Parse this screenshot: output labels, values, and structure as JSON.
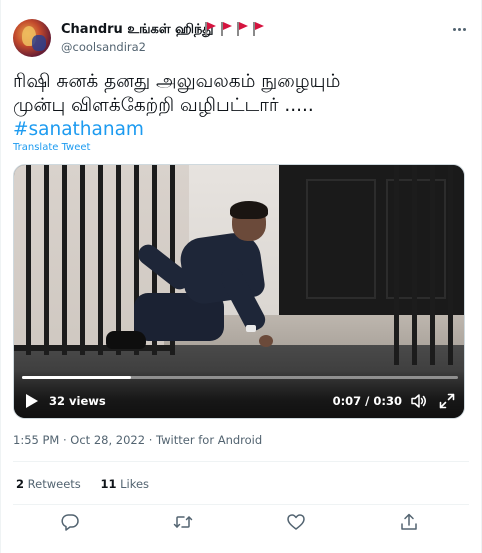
{
  "author": {
    "display_name": "Chandru உங்கள் ஹிந்து",
    "username": "@coolsandira2",
    "flag_icons": [
      "red-flag-icon",
      "red-flag-icon",
      "red-flag-icon",
      "red-flag-icon"
    ]
  },
  "tweet": {
    "text_line1": "ரிஷி சுனக் தனது அலுவலகம் நுழையும்",
    "text_line2": "முன்பு விளக்கேற்றி வழிபட்டார் .....",
    "hashtag": "#sanathanam",
    "translate_label": "Translate Tweet"
  },
  "video": {
    "views": "32 views",
    "time": "0:07 / 0:30",
    "progress": 0.25,
    "icons": [
      "play-icon",
      "volume-icon",
      "expand-icon"
    ]
  },
  "meta": {
    "timestamp": "1:55 PM · Oct 28, 2022",
    "separator": " · ",
    "source": "Twitter for Android"
  },
  "stats": {
    "retweets_count": "2",
    "retweets_label": "Retweets",
    "likes_count": "11",
    "likes_label": "Likes"
  },
  "actions": [
    "reply-icon",
    "retweet-icon",
    "like-icon",
    "share-icon"
  ],
  "colors": {
    "accent": "#1d9bf0",
    "text": "#0f1419",
    "secondary": "#536471",
    "flag": "#e0245e"
  }
}
